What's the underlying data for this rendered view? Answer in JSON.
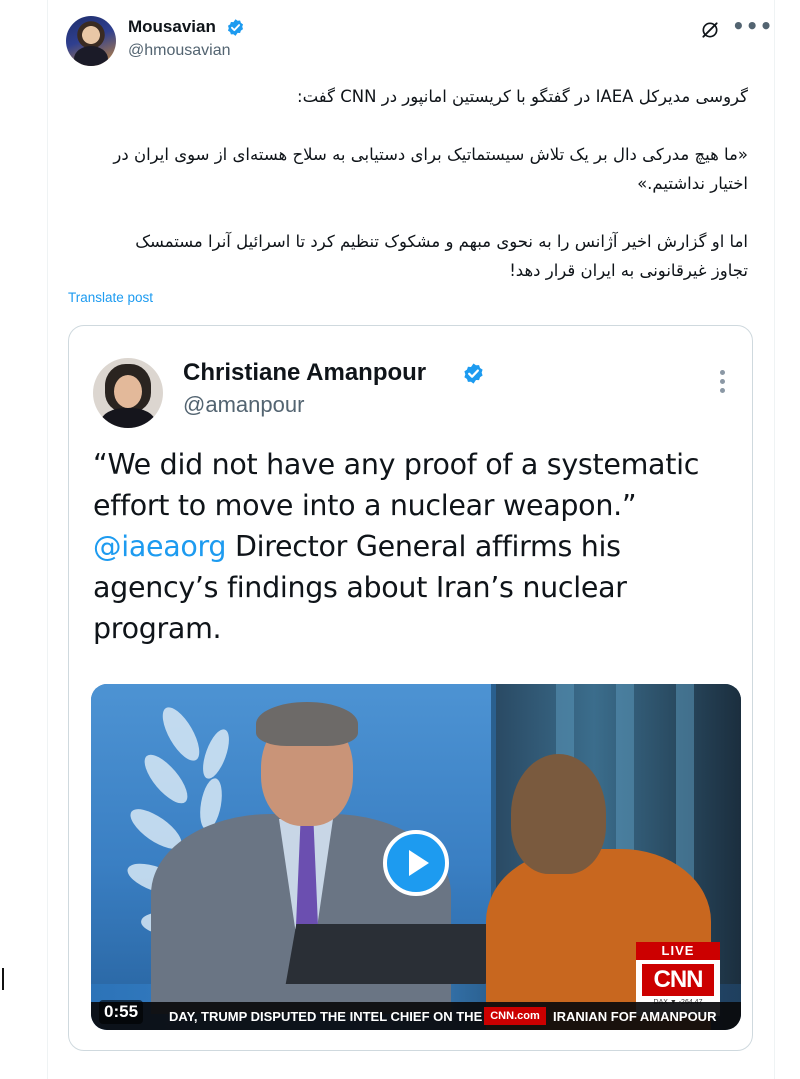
{
  "post": {
    "author_name": "Mousavian",
    "author_handle": "@hmousavian",
    "icons": [
      "verified-badge-icon",
      "grok-icon",
      "more-options-icon"
    ],
    "text_paragraphs": [
      "گروسی مدیرکل IAEA در گفتگو با کریستین امانپور در CNN گفت:",
      "«ما هیچ مدرکی دال بر یک تلاش سیستماتیک برای دستیابی به سلاح هسته‌ای از سوی ایران در اختیار نداشتیم.»",
      "اما او گزارش اخیر آژانس را به نحوی مبهم و مشکوک تنظیم کرد تا اسرائیل آنرا مستمسک تجاوز غیرقانونی به ایران قرار دهد!"
    ],
    "translate_label": "Translate post"
  },
  "quoted_post": {
    "author_name": "Christiane Amanpour",
    "author_handle": "@amanpour",
    "text_quote": "“We did not have any proof of a systematic effort to move into a nuclear weapon.”",
    "text_mention": "@iaeaorg",
    "text_rest": " Director General affirms his agency’s findings about Iran’s nuclear program.",
    "video": {
      "duration": "0:55",
      "live_label": "LIVE",
      "network_logo": "CNN",
      "dax_text": "DAX ▼ -264.47",
      "ticker_left": "DAY, TRUMP DISPUTED THE INTEL CHIEF ON THE ISSUE.",
      "ticker_logo": "CNN.com",
      "ticker_right": "IRANIAN FOF AMANPOUR"
    }
  },
  "colors": {
    "accent": "#1d9bf0",
    "text_primary": "#0f1419",
    "text_secondary": "#536471",
    "cnn_red": "#cc0000"
  }
}
